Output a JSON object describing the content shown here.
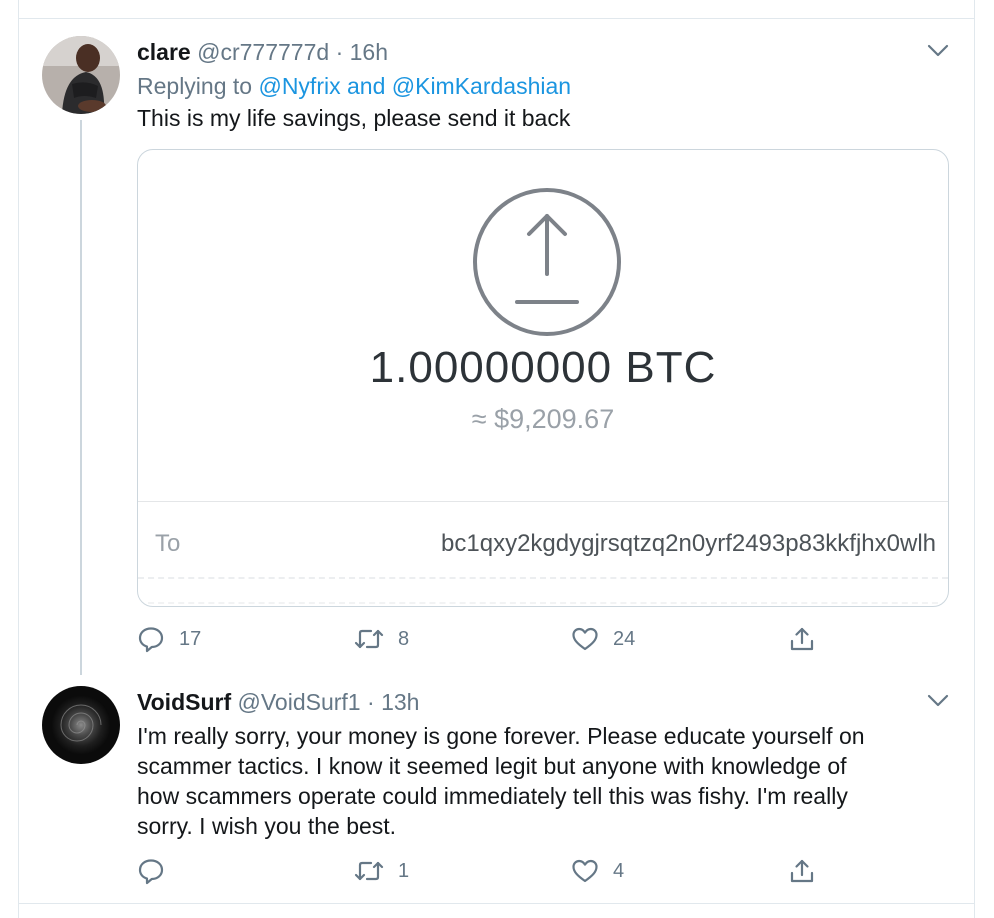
{
  "tweets": [
    {
      "display_name": "clare",
      "handle": "@cr777777d",
      "time": "16h",
      "replying_prefix": "Replying to",
      "reply_to_1": "@Nyfrix",
      "reply_to_join": "and",
      "reply_to_2": "@KimKardashian",
      "text": "This is my life savings, please send it back",
      "card": {
        "btc_amount": "1.00000000 BTC",
        "usd_amount": "≈ $9,209.67",
        "to_label": "To",
        "to_address": "bc1qxy2kgdygjrsqtzq2n0yrf2493p83kkfjhx0wlh"
      },
      "actions": {
        "replies": "17",
        "retweets": "8",
        "likes": "24"
      },
      "icons": [
        "avatar",
        "chevron-down-icon",
        "reply-icon",
        "retweet-icon",
        "like-icon",
        "share-icon",
        "upload-arrow-icon"
      ]
    },
    {
      "display_name": "VoidSurf",
      "handle": "@VoidSurf1",
      "time": "13h",
      "text_lines": [
        "I'm really sorry, your money is gone forever. Please educate yourself on",
        "scammer tactics. I know it seemed legit but anyone with knowledge of",
        "how scammers operate could immediately tell this was fishy. I'm really",
        "sorry. I wish you the best."
      ],
      "actions": {
        "replies": "",
        "retweets": "1",
        "likes": "4"
      }
    }
  ],
  "separator": "·",
  "colors": {
    "link": "#1b95e0",
    "muted": "#657786",
    "border": "#e1e8ed"
  }
}
